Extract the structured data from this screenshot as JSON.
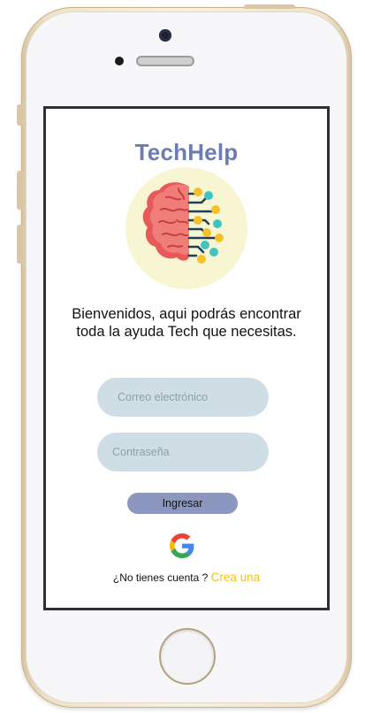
{
  "app": {
    "title": "TechHelp",
    "welcome_text": "Bienvenidos, aqui podrás encontrar toda la ayuda Tech que necesitas."
  },
  "login": {
    "email_placeholder": "Correo electrónico",
    "password_placeholder": "Contraseña",
    "submit_label": "Ingresar"
  },
  "signup": {
    "prompt": "¿No tienes cuenta ? ",
    "link_label": "Crea una"
  },
  "icons": {
    "logo": "brain-circuit-icon",
    "google": "google-icon"
  },
  "colors": {
    "title": "#6d7db3",
    "input_bg": "#cfdee5",
    "button_bg": "#8b97bf",
    "link": "#f2c218",
    "logo_bg": "#f8f6d2"
  }
}
